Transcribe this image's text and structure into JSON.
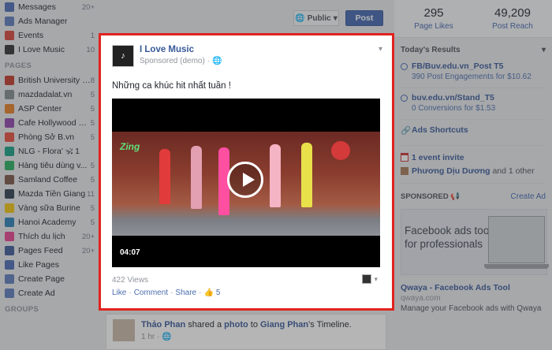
{
  "sidebar": {
    "top_items": [
      {
        "label": "Messages",
        "count": "20+",
        "color": "#4a6bb5"
      },
      {
        "label": "Ads Manager",
        "count": "",
        "color": "#5b7bbd"
      },
      {
        "label": "Events",
        "count": "1",
        "color": "#d8453c"
      },
      {
        "label": "I Love Music",
        "count": "10",
        "color": "#2f2f2f"
      }
    ],
    "pages_heading": "PAGES",
    "pages": [
      {
        "label": "British University Vi...",
        "count": "8",
        "color": "#c0392b"
      },
      {
        "label": "mazdadalat.vn",
        "count": "5",
        "color": "#7f8c8d"
      },
      {
        "label": "ASP Center",
        "count": "5",
        "color": "#e67e22"
      },
      {
        "label": "Cafe Hollywood Vi...",
        "count": "5",
        "color": "#8e44ad"
      },
      {
        "label": "Phòng Sở B.vn",
        "count": "5",
        "color": "#e74c3c"
      },
      {
        "label": "NLG - Flora' 🕉 1",
        "count": "",
        "color": "#16a085"
      },
      {
        "label": "Hàng tiêu dùng v...",
        "count": "5",
        "color": "#27ae60"
      },
      {
        "label": "Samland Coffee",
        "count": "5",
        "color": "#795548"
      },
      {
        "label": "Mazda Tiền Giang",
        "count": "11",
        "color": "#2c3e50"
      },
      {
        "label": "Vàng sữa Burine",
        "count": "5",
        "color": "#f1c40f"
      },
      {
        "label": "Hanoi Academy",
        "count": "5",
        "color": "#2980b9"
      },
      {
        "label": "Thích du lịch",
        "count": "20+",
        "color": "#e84393"
      },
      {
        "label": "Pages Feed",
        "count": "20+",
        "color": "#3b5998"
      },
      {
        "label": "Like Pages",
        "count": "",
        "color": "#4a6bb5"
      },
      {
        "label": "Create Page",
        "count": "",
        "color": "#5b7bbd"
      },
      {
        "label": "Create Ad",
        "count": "",
        "color": "#5b7bbd"
      }
    ],
    "groups_heading": "GROUPS"
  },
  "composer": {
    "privacy_label": "Public",
    "post_label": "Post"
  },
  "post": {
    "page_name": "I Love Music",
    "sponsored": "Sponsored (demo) ·",
    "text": "Những ca khúc hit nhất tuần !",
    "video_brand": "Zing",
    "video_time": "04:07",
    "views": "422 Views",
    "action_like": "Like",
    "action_comment": "Comment",
    "action_share": "Share",
    "like_count": "5"
  },
  "story": {
    "author": "Thảo Phan",
    "action_prefix": " shared a ",
    "object": "photo",
    "action_mid": " to ",
    "target": "Giang Phan",
    "action_suffix": "'s Timeline.",
    "time": "1 hr"
  },
  "right": {
    "page_likes_num": "295",
    "page_likes_label": "Page Likes",
    "reach_num": "49,209",
    "reach_label": "Post Reach",
    "results_heading": "Today's Results",
    "results": [
      {
        "link": "FB/Buv.edu.vn_Post T5",
        "sub": "390 Post Engagements for $10.62"
      },
      {
        "link": "buv.edu.vn/Stand_T5",
        "sub": "0 Conversions for $1.53"
      }
    ],
    "ads_shortcuts": "Ads Shortcuts",
    "event_invite": "1 event invite",
    "event_person": "Phương Dịu Dương",
    "event_other": " and 1 other",
    "sponsored_heading": "SPONSORED",
    "create_ad": "Create Ad",
    "ad_image_text": "Facebook ads tool for professionals",
    "ad_title": "Qwaya - Facebook Ads Tool",
    "ad_url": "qwaya.com",
    "ad_desc": "Manage your Facebook ads with Qwaya"
  },
  "colors": {
    "highlight": "#e0221e",
    "brand_blue": "#4267b2",
    "link_blue": "#365899"
  }
}
